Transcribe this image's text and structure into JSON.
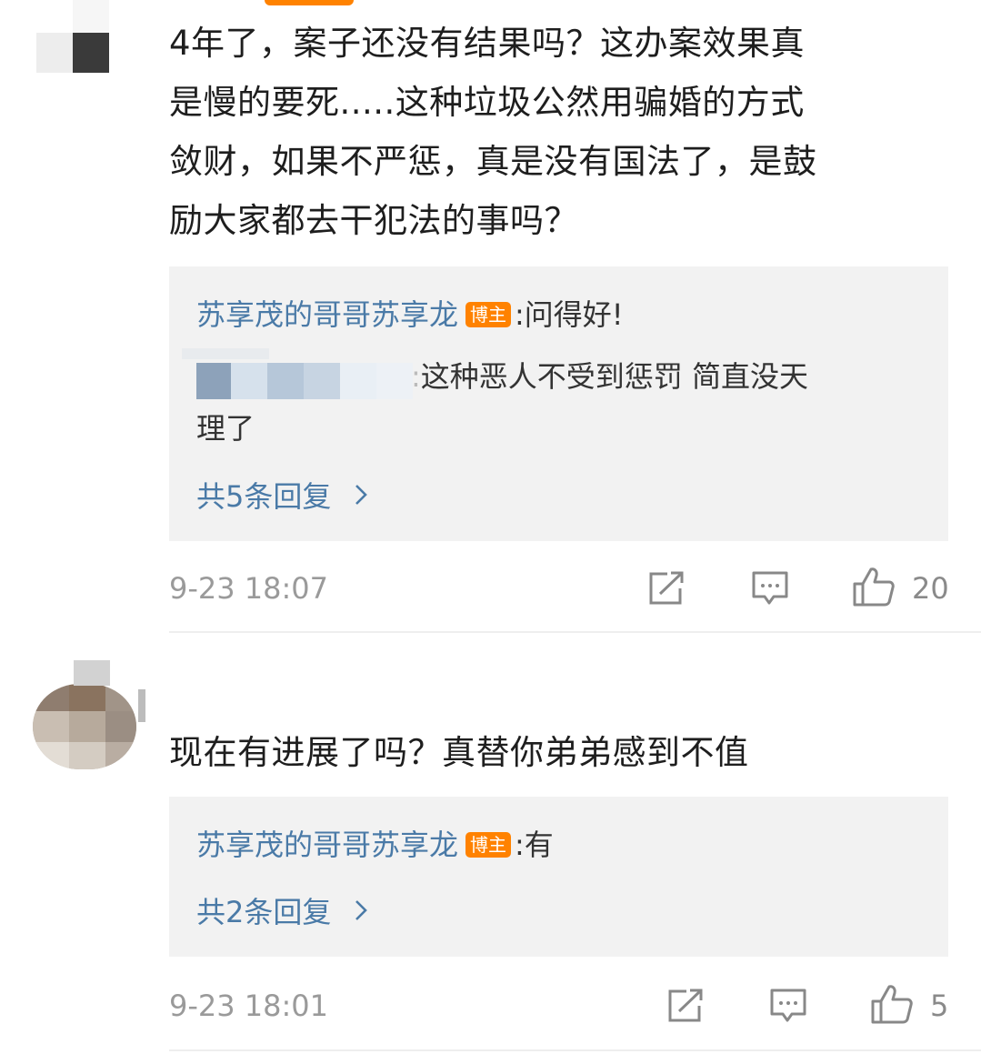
{
  "comments": [
    {
      "text_lines": [
        "4年了，案子还没有结果吗？这办案效果真",
        "是慢的要死.....这种垃圾公然用骗婚的方式",
        "敛财，如果不严惩，真是没有国法了，是鼓",
        "励大家都去干犯法的事吗？"
      ],
      "replies": [
        {
          "author": "苏享茂的哥哥苏享龙",
          "badge": "博主",
          "separator": ":",
          "text": "问得好!"
        },
        {
          "author": "",
          "separator": ":",
          "text_line1": "这种恶人不受到惩罚 简直没天",
          "text_line2": "理了"
        }
      ],
      "more_replies": "共5条回复",
      "more_arrow": ">",
      "time": "9-23 18:07",
      "like_count": "20",
      "icons": [
        "share-icon",
        "comment-icon",
        "like-icon"
      ]
    },
    {
      "text": "现在有进展了吗？真替你弟弟感到不值",
      "replies": [
        {
          "author": "苏享茂的哥哥苏享龙",
          "badge": "博主",
          "separator": ":",
          "text": "有"
        }
      ],
      "more_replies": "共2条回复",
      "more_arrow": ">",
      "time": "9-23 18:01",
      "like_count": "5",
      "icons": [
        "share-icon",
        "comment-icon",
        "like-icon"
      ]
    }
  ],
  "colors": {
    "author_link": "#4a7aa7",
    "badge": "#ff8200",
    "reply_background": "#f2f2f2",
    "muted_text": "#9a9a9a"
  }
}
